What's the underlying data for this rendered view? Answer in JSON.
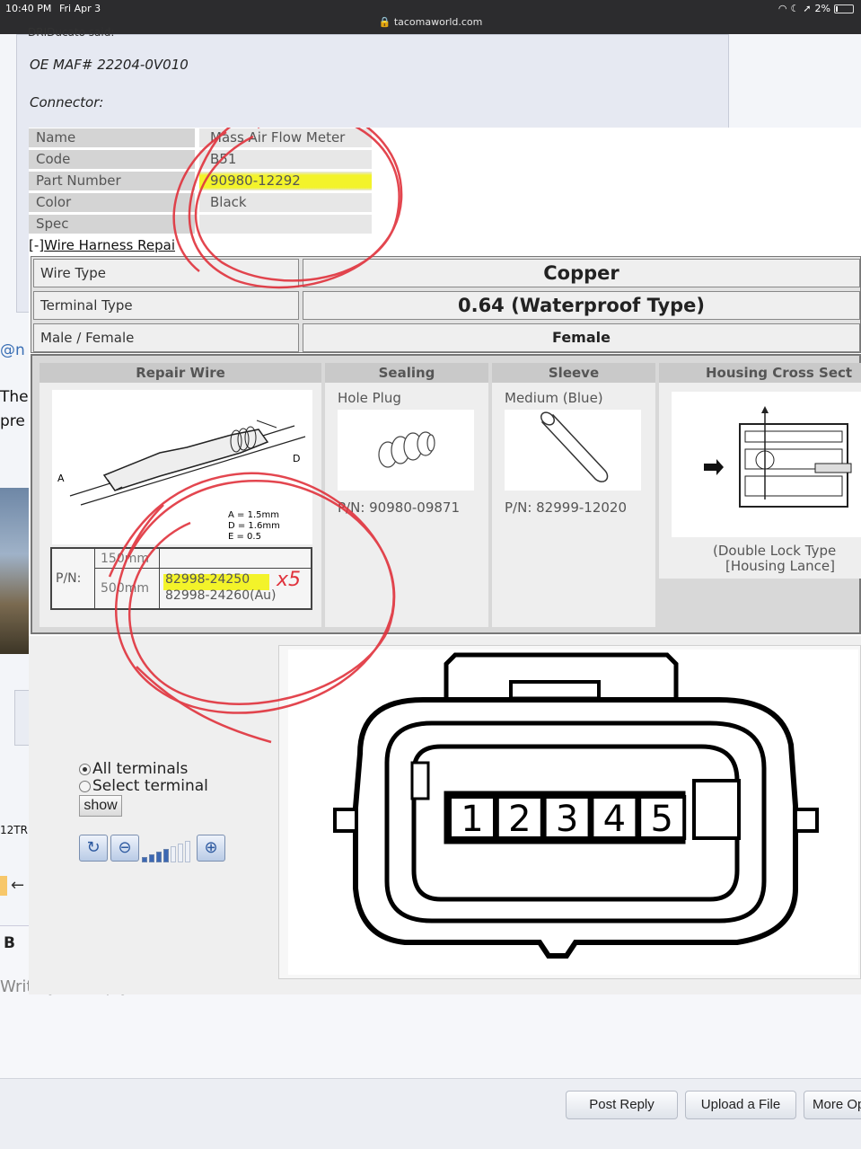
{
  "status_bar": {
    "time": "10:40 PM",
    "date": "Fri Apr 3",
    "url": "tacomaworld.com",
    "battery": "2%"
  },
  "forum": {
    "quote_author": "DRIDucato said:",
    "oe_maf": "OE MAF# 22204-0V010",
    "connector_label": "Connector:",
    "mention_clip": "@n",
    "text_clip_1": "The",
    "text_clip_2": "pre",
    "user_clip": "12TR",
    "bold_label": "B",
    "reply_placeholder": "Write your reply...",
    "buttons": {
      "post_reply": "Post Reply",
      "upload_file": "Upload a File",
      "more_options": "More Op"
    }
  },
  "connector_info": {
    "rows": [
      {
        "key": "Name",
        "value": "Mass Air Flow Meter"
      },
      {
        "key": "Code",
        "value": "B51"
      },
      {
        "key": "Part Number",
        "value": "90980-12292"
      },
      {
        "key": "Color",
        "value": "Black"
      },
      {
        "key": "Spec",
        "value": ""
      }
    ],
    "harness_link_prefix": "[-]",
    "harness_link_text": "Wire Harness Repai"
  },
  "wire_table": {
    "wire_type_label": "Wire Type",
    "wire_type_value": "Copper",
    "terminal_type_label": "Terminal Type",
    "terminal_type_value": "0.64 (Waterproof Type)",
    "gender_label": "Male / Female",
    "gender_value": "Female"
  },
  "repair": {
    "columns": {
      "repair_wire": "Repair Wire",
      "sealing": "Sealing",
      "sleeve": "Sleeve",
      "housing": "Housing Cross Sect"
    },
    "sealing_name": "Hole Plug",
    "sealing_pn": "P/N: 90980-09871",
    "sleeve_name": "Medium (Blue)",
    "sleeve_pn": "P/N: 82999-12020",
    "housing_caption_1": "(Double Lock Type",
    "housing_caption_2": "[Housing Lance]",
    "diagram_labels": {
      "a_label": "A",
      "d_label": "D",
      "a": "A = 1.5mm",
      "d": "D = 1.6mm",
      "e": "E = 0.5"
    },
    "pn_table": {
      "label": "P/N:",
      "len_short": "150mm",
      "len_long": "500mm",
      "pn_1": "82998-24250",
      "pn_2": "82998-24260(Au)",
      "handwritten_note": "x5"
    }
  },
  "terminal_panel": {
    "radio_all": "All terminals",
    "radio_select": "Select terminal",
    "show_button": "show",
    "zoom_level_bars_filled": 4,
    "zoom_level_bars_total": 7,
    "pins": [
      "1",
      "2",
      "3",
      "4",
      "5"
    ]
  },
  "colors": {
    "annotation_red": "#e0323c",
    "highlight_yellow": "#f3f32a"
  }
}
